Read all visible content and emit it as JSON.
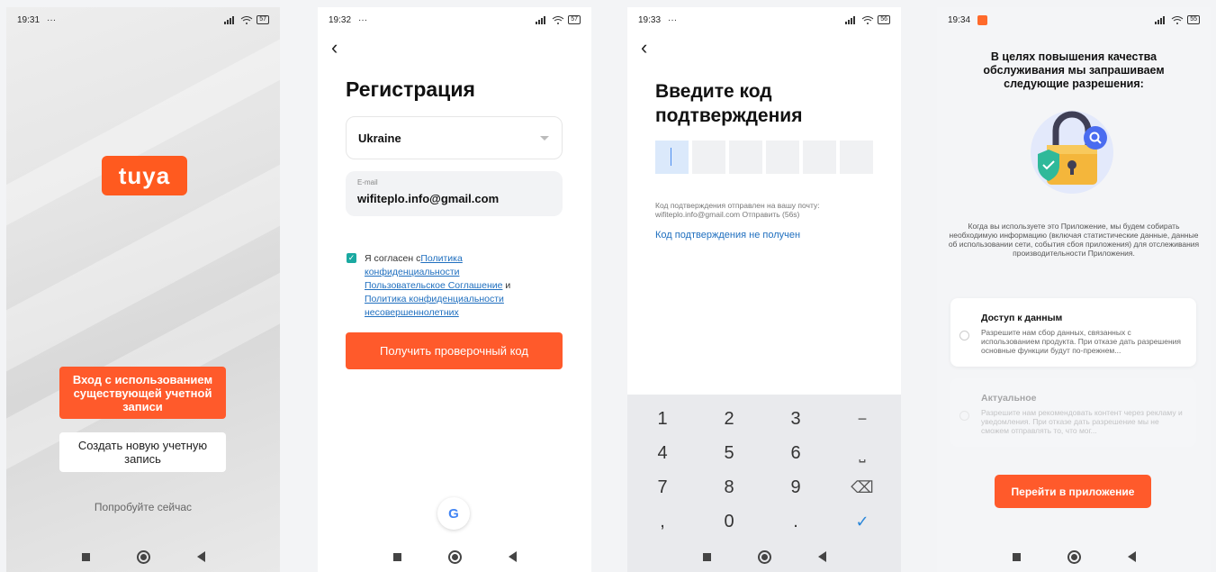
{
  "screens": [
    {
      "time": "19:31",
      "dots": "···",
      "battery": "57",
      "logo": "tuya",
      "login_button": "Вход с использованием существующей учетной записи",
      "create_button": "Создать новую учетную запись",
      "try_now": "Попробуйте сейчас"
    },
    {
      "time": "19:32",
      "dots": "···",
      "battery": "57",
      "back": "‹",
      "title": "Регистрация",
      "country": "Ukraine",
      "email_label": "E-mail",
      "email_value": "wifiteplo.info@gmail.com",
      "agree_prefix": "Я согласен с",
      "link_privacy": "Политика конфиденциальности",
      "link_user_agreement": "Пользовательское Соглашение",
      "agree_and": " и ",
      "link_minors": "Политика конфиденциальности несовершеннолетних",
      "get_code_button": "Получить проверочный код",
      "google": "G"
    },
    {
      "time": "19:33",
      "dots": "···",
      "battery": "56",
      "back": "‹",
      "title": "Введите код подтверждения",
      "info": "Код подтверждения отправлен на вашу почту: wifiteplo.info@gmail.com Отправить (56s)",
      "not_received": "Код подтверждения не получен",
      "keys": [
        "1",
        "2",
        "3",
        "−",
        "4",
        "5",
        "6",
        "⎵",
        "7",
        "8",
        "9",
        "⌫",
        ",",
        "0",
        ".",
        "✓"
      ]
    },
    {
      "time": "19:34",
      "battery": "55",
      "title": "В целях повышения качества обслуживания мы запрашиваем следующие разрешения:",
      "description": "Когда вы используете это Приложение, мы будем собирать необходимую информацию (включая статистические данные, данные об использовании сети, события сбоя приложения) для отслеживания производительности Приложения.",
      "perm1_title": "Доступ к данным",
      "perm1_text": "Разрешите нам сбор данных, связанных с использованием продукта. При отказе дать разрешения основные функции будут по-прежнем...",
      "perm2_title": "Актуальное",
      "perm2_text": "Разрешите нам рекомендовать контент через рекламу и уведомления. При отказе дать разрешение мы не сможем отправлять то, что мог...",
      "go_button": "Перейти в приложение"
    }
  ],
  "colors": {
    "accent": "#ff5a2b",
    "link": "#1f6fbf",
    "check": "#1aa9a1"
  }
}
